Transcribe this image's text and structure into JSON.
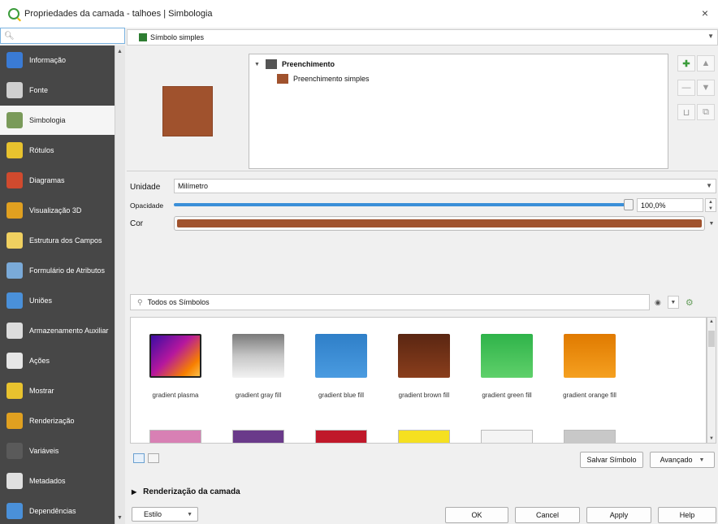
{
  "window": {
    "title": "Propriedades da camada - talhoes | Simbologia",
    "close_glyph": "×"
  },
  "sidebar": {
    "search_placeholder": "",
    "items": [
      {
        "label": "Informação",
        "icon": "info-icon",
        "color": "#3a7bd5"
      },
      {
        "label": "Fonte",
        "icon": "source-icon",
        "color": "#cfcfcf"
      },
      {
        "label": "Simbologia",
        "icon": "symbology-brush-icon",
        "color": "#7a9a5a"
      },
      {
        "label": "Rótulos",
        "icon": "labels-abc-icon",
        "color": "#e8c22e"
      },
      {
        "label": "Diagramas",
        "icon": "diagram-icon",
        "color": "#d04a2e"
      },
      {
        "label": "Visualização 3D",
        "icon": "3d-cube-icon",
        "color": "#e0a020"
      },
      {
        "label": "Estrutura dos Campos",
        "icon": "fields-icon",
        "color": "#f0d060"
      },
      {
        "label": "Formulário de Atributos",
        "icon": "form-icon",
        "color": "#7aaad8"
      },
      {
        "label": "Uniões",
        "icon": "join-icon",
        "color": "#4a90d9"
      },
      {
        "label": "Armazenamento Auxiliar",
        "icon": "storage-icon",
        "color": "#dcdcdc"
      },
      {
        "label": "Ações",
        "icon": "gear-icon",
        "color": "#e6e6e6"
      },
      {
        "label": "Mostrar",
        "icon": "speech-bubble-icon",
        "color": "#e8c22e"
      },
      {
        "label": "Renderização",
        "icon": "paint-brush-icon",
        "color": "#e0a020"
      },
      {
        "label": "Variáveis",
        "icon": "variables-icon",
        "color": "#5a5a5a"
      },
      {
        "label": "Metadados",
        "icon": "metadata-icon",
        "color": "#e0e0e0"
      },
      {
        "label": "Dependências",
        "icon": "dependencies-icon",
        "color": "#4a90d9"
      }
    ],
    "active_index": 2
  },
  "symbol_type": {
    "label": "Símbolo simples"
  },
  "preview": {
    "fill_color": "#a0522d"
  },
  "layer_tree": {
    "root_label": "Preenchimento",
    "child_label": "Preenchimento simples",
    "root_color": "#555555",
    "child_color": "#a0522d"
  },
  "properties": {
    "unit_label": "Unidade",
    "unit_value": "Milímetro",
    "opacity_label": "Opacidade",
    "opacity_value": "100,0%",
    "opacity_fraction": 1.0,
    "color_label": "Cor",
    "color_value": "#a0522d"
  },
  "library": {
    "search_placeholder": "Todos os Símbolos",
    "items": [
      {
        "name": "gradient plasma",
        "fill": "linear-gradient(135deg,#3a0ca3,#b5179e 45%,#f77f00 80%,#fcbf49)"
      },
      {
        "name": "gradient  gray fill",
        "fill": "linear-gradient(180deg,#7a7a7a,#c6c6c6 50%,#f2f2f2)"
      },
      {
        "name": "gradient blue fill",
        "fill": "linear-gradient(180deg,#2f7fc8,#4a9be0)"
      },
      {
        "name": "gradient brown fill",
        "fill": "linear-gradient(180deg,#5a2612,#8a3e1c)"
      },
      {
        "name": "gradient green fill",
        "fill": "linear-gradient(180deg,#2fb34a,#5fd06a)"
      },
      {
        "name": "gradient orange fill",
        "fill": "linear-gradient(180deg,#e07a00,#f5a020)"
      }
    ],
    "row2_colors": [
      "#d880b4",
      "#6a3a8a",
      "#c0182a",
      "#f5e020",
      "#f4f4f4",
      "#c8c8c8"
    ]
  },
  "buttons": {
    "save_symbol": "Salvar Símbolo",
    "advanced": "Avançado",
    "ok": "OK",
    "cancel": "Cancel",
    "apply": "Apply",
    "help": "Help",
    "style": "Estilo"
  },
  "render_section": {
    "label": "Renderização da camada"
  }
}
